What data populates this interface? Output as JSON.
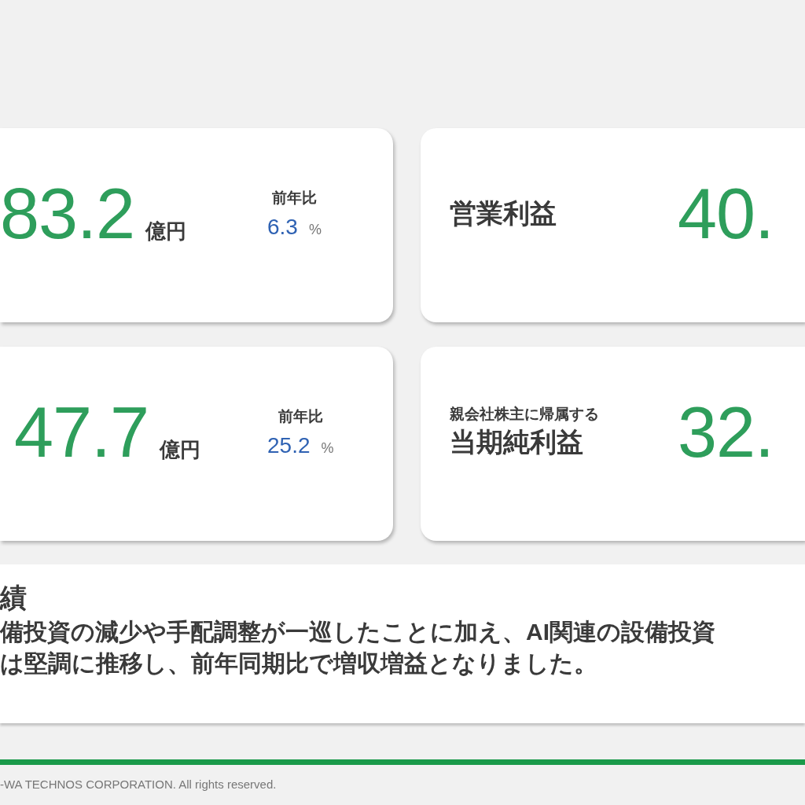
{
  "cards": [
    {
      "kind": "amount",
      "value": "83.2",
      "unit": "億円",
      "change_label": "前年比",
      "change_value": "6.3",
      "change_unit": "%"
    },
    {
      "kind": "headline",
      "label": "営業利益",
      "value": "40."
    },
    {
      "kind": "amount",
      "value": "47.7",
      "unit": "億円",
      "change_label": "前年比",
      "change_value": "25.2",
      "change_unit": "%"
    },
    {
      "kind": "headline",
      "sublabel": "親会社株主に帰属する",
      "label": "当期純利益",
      "value": "32."
    }
  ],
  "summary": {
    "title": "績",
    "lines": [
      "備投資の減少や手配調整が一巡したことに加え、AI関連の設備投資",
      "は堅調に推移し、前年同期比で増収増益となりました。"
    ]
  },
  "footer": {
    "copyright": "-WA TECHNOS CORPORATION. All rights reserved."
  }
}
